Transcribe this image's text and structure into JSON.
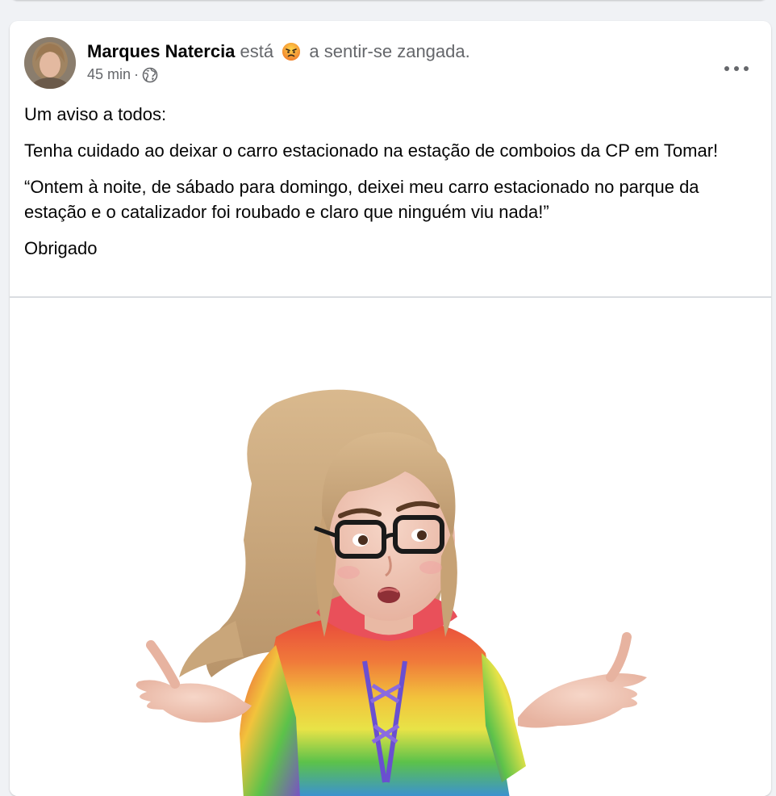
{
  "post": {
    "author": "Marques Natercia",
    "feeling_prefix": "está",
    "feeling_emoji": "angry-face-icon",
    "feeling_text": "a sentir-se zangada.",
    "time": "45 min",
    "separator": "·",
    "audience_icon": "globe-icon",
    "more_icon": "more-options-icon",
    "paragraphs": [
      "Um aviso a todos:",
      "Tenha cuidado ao deixar o carro estacionado na estação de comboios da CP em Tomar!",
      "“Ontem à noite, de sábado para domingo, deixei meu carro estacionado no parque da estação e o catalizador foi roubado e claro que ninguém viu nada!”",
      "Obrigado"
    ],
    "image": "avatar-shrug-sticker"
  },
  "colors": {
    "background": "#f0f2f5",
    "card": "#ffffff",
    "secondary_text": "#65676b",
    "primary_text": "#050505"
  }
}
